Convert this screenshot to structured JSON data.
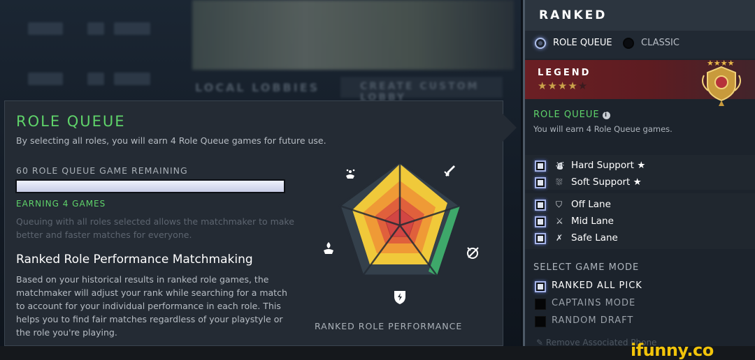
{
  "tooltip": {
    "title": "ROLE QUEUE",
    "description": "By selecting all roles, you will earn 4 Role Queue games for future use.",
    "remaining_label": "60 ROLE QUEUE GAME REMAINING",
    "progress_fraction": 1.0,
    "earning_label": "EARNING 4 GAMES",
    "queuing_text": "Queuing with all roles selected allows the matchmaker to make better and faster matches for everyone.",
    "matchmaking_title": "Ranked Role Performance Matchmaking",
    "matchmaking_text": "Based on your historical results in ranked role games, the matchmaker will adjust your rank while searching for a match to account for your individual performance in each role. This helps you to find fair matches regardless of your playstyle or the role you're playing.",
    "performance_label": "RANKED ROLE PERFORMANCE",
    "radar_icons": [
      "soft-support-icon",
      "safe-lane-icon",
      "off-lane-icon",
      "mid-lane-icon",
      "hard-support-icon"
    ]
  },
  "side": {
    "title": "RANKED",
    "modes": [
      {
        "label": "ROLE QUEUE",
        "selected": true
      },
      {
        "label": "CLASSIC",
        "selected": false
      }
    ],
    "rank": {
      "name": "LEGEND",
      "stars": "★★★★",
      "empty_stars": "★"
    },
    "role_queue_label": "ROLE QUEUE",
    "info_glyph": "i",
    "earn_text": "You will earn 4 Role Queue games.",
    "roles": [
      {
        "label": "Hard Support",
        "star": "★",
        "icon": "hard-support-icon",
        "glyph": "⛇",
        "checked": true
      },
      {
        "label": "Soft Support",
        "star": "★",
        "icon": "soft-support-icon",
        "glyph": "⛆",
        "checked": true
      },
      {
        "label": "Off Lane",
        "star": "",
        "icon": "off-lane-icon",
        "glyph": "⛉",
        "checked": true
      },
      {
        "label": "Mid Lane",
        "star": "",
        "icon": "mid-lane-icon",
        "glyph": "⚔",
        "checked": true
      },
      {
        "label": "Safe Lane",
        "star": "",
        "icon": "safe-lane-icon",
        "glyph": "✗",
        "checked": true
      }
    ],
    "select_game_mode_label": "SELECT GAME MODE",
    "game_modes": [
      {
        "label": "RANKED ALL PICK",
        "checked": true,
        "color": "#ffffff"
      },
      {
        "label": "CAPTAINS MODE",
        "checked": false,
        "color": "#9aa1a9"
      },
      {
        "label": "RANDOM DRAFT",
        "checked": false,
        "color": "#9aa1a9"
      }
    ],
    "phone_text": "Remove Associated Phone"
  },
  "background": {
    "lobby_label": "LOCAL LOBBIES",
    "create_label": "CREATE CUSTOM LOBBY"
  },
  "watermark": "ifunny.co",
  "colors": {
    "accent_green": "#5fd36a",
    "panel": "#242b34",
    "legend_red": "#6b1f24"
  }
}
